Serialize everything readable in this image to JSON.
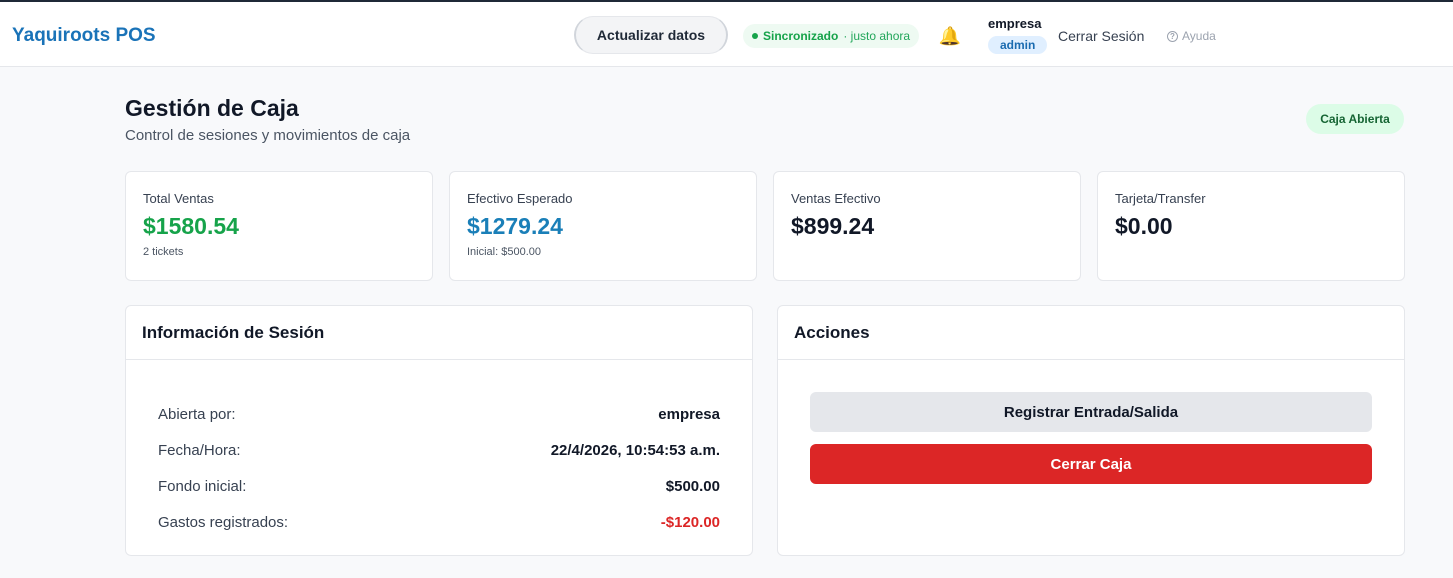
{
  "header": {
    "brand": "Yaquiroots POS",
    "refresh_label": "Actualizar datos",
    "sync_status": "Sincronizado",
    "sync_time": "· justo ahora",
    "user_name": "empresa",
    "user_role": "admin",
    "logout_label": "Cerrar Sesión",
    "help_label": "Ayuda"
  },
  "page": {
    "title": "Gestión de Caja",
    "subtitle": "Control de sesiones y movimientos de caja",
    "status": "Caja Abierta"
  },
  "stats": [
    {
      "label": "Total Ventas",
      "value": "$1580.54",
      "note": "2 tickets",
      "color": "#16a34a"
    },
    {
      "label": "Efectivo Esperado",
      "value": "$1279.24",
      "note": "Inicial: $500.00",
      "color": "#1a7fb8"
    },
    {
      "label": "Ventas Efectivo",
      "value": "$899.24",
      "note": "",
      "color": "#111827"
    },
    {
      "label": "Tarjeta/Transfer",
      "value": "$0.00",
      "note": "",
      "color": "#111827"
    }
  ],
  "session": {
    "title": "Información de Sesión",
    "rows": [
      {
        "label": "Abierta por:",
        "value": "empresa"
      },
      {
        "label": "Fecha/Hora:",
        "value": "22/4/2026, 10:54:53 a.m."
      },
      {
        "label": "Fondo inicial:",
        "value": "$500.00"
      },
      {
        "label": "Gastos registrados:",
        "value": "-$120.00"
      }
    ]
  },
  "actions": {
    "title": "Acciones",
    "register_label": "Registrar Entrada/Salida",
    "close_label": "Cerrar Caja"
  },
  "colors": {
    "brand": "#1a73b8",
    "success": "#16a34a",
    "danger": "#dc2626"
  }
}
